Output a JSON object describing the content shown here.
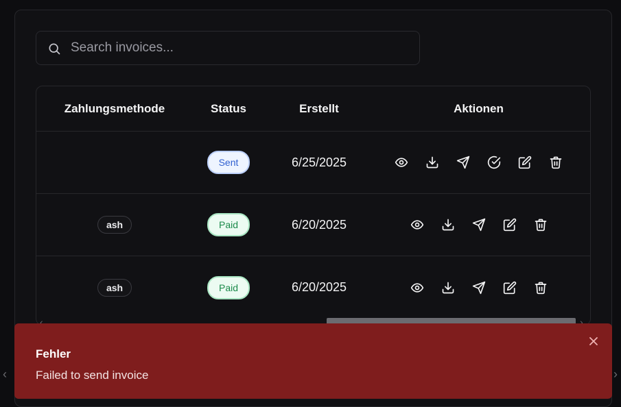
{
  "search": {
    "placeholder": "Search invoices..."
  },
  "table": {
    "headers": {
      "payment_method": "Zahlungsmethode",
      "status": "Status",
      "created": "Erstellt",
      "actions": "Aktionen"
    },
    "rows": [
      {
        "payment_method": "",
        "status": "Sent",
        "created": "6/25/2025",
        "actions": [
          "view-icon",
          "download-icon",
          "send-icon",
          "mark-paid-icon",
          "edit-icon",
          "delete-icon"
        ]
      },
      {
        "payment_method": "ash",
        "status": "Paid",
        "created": "6/20/2025",
        "actions": [
          "view-icon",
          "download-icon",
          "send-icon",
          "edit-icon",
          "delete-icon"
        ]
      },
      {
        "payment_method": "ash",
        "status": "Paid",
        "created": "6/20/2025",
        "actions": [
          "view-icon",
          "download-icon",
          "send-icon",
          "edit-icon",
          "delete-icon"
        ]
      }
    ]
  },
  "toast": {
    "title": "Fehler",
    "message": "Failed to send invoice",
    "color": "#7f1d1d"
  },
  "colors": {
    "background": "#0d0d10",
    "sent_badge": "#2f5fd0",
    "paid_badge": "#1b8a4a"
  }
}
